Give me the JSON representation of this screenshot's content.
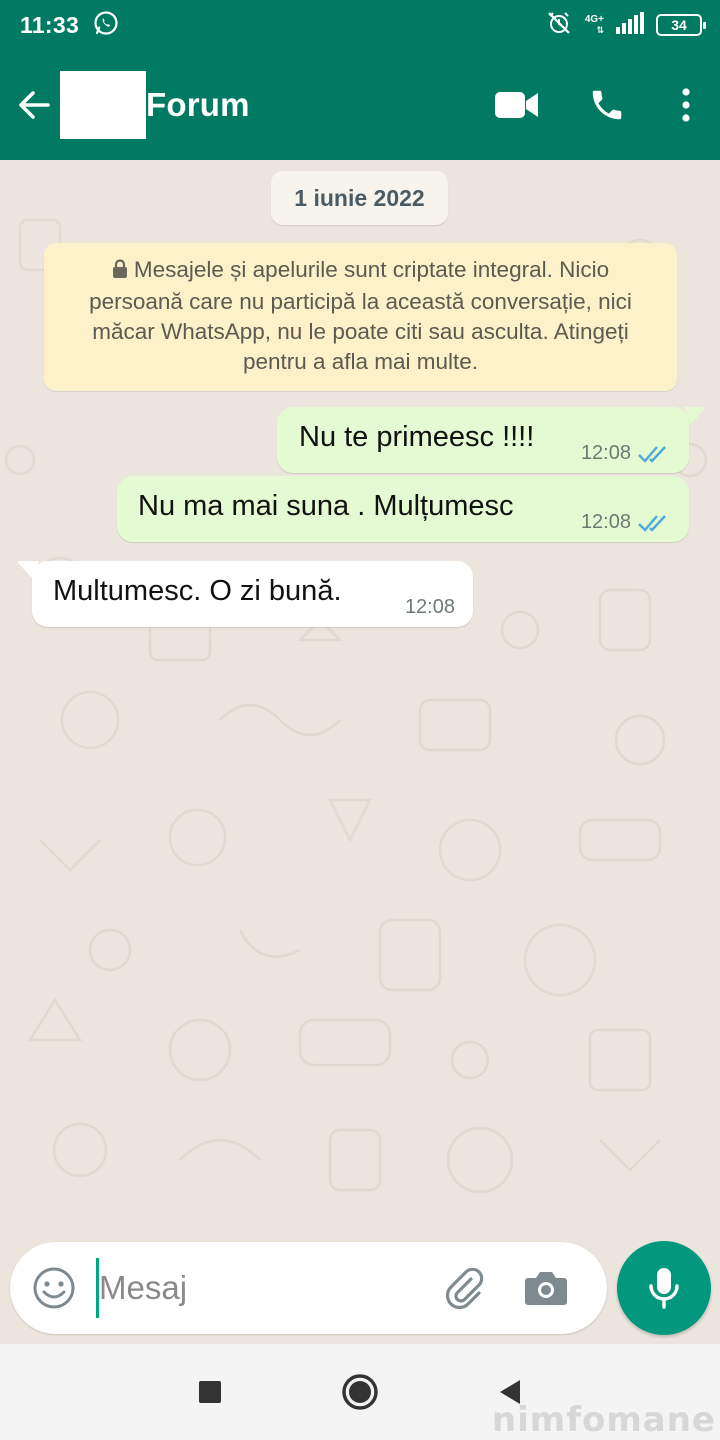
{
  "status_bar": {
    "time": "11:33",
    "network": "4G+",
    "battery": "34"
  },
  "header": {
    "title": "Forum"
  },
  "chat": {
    "date_chip": "1 iunie 2022",
    "encryption_notice": "Mesajele și apelurile sunt criptate integral. Nicio persoană care nu participă la această conversație, nici măcar WhatsApp, nu le poate citi sau asculta. Atingeți pentru a afla mai multe.",
    "messages": [
      {
        "direction": "outgoing",
        "text": "Nu te primeesc !!!!",
        "time": "12:08",
        "status": "read"
      },
      {
        "direction": "outgoing",
        "text": "Nu ma mai suna . Mulțumesc",
        "time": "12:08",
        "status": "read"
      },
      {
        "direction": "incoming",
        "text": "Multumesc. O zi bună.",
        "time": "12:08"
      }
    ]
  },
  "composer": {
    "placeholder": "Mesaj"
  },
  "watermark": "nimfomane",
  "colors": {
    "header": "#017a64",
    "background": "#ece5dd",
    "outgoing_bubble": "#e3fad2",
    "incoming_bubble": "#ffffff",
    "notice_bubble": "#fcf1c9",
    "read_ticks": "#4fa9d8",
    "mic_button": "#03977d"
  },
  "icons": {
    "status": [
      "whatsapp-icon",
      "alarm-off-icon",
      "signal-icon",
      "battery-icon"
    ],
    "header": [
      "back-arrow-icon",
      "video-call-icon",
      "phone-icon",
      "more-vert-icon"
    ],
    "composer": [
      "emoji-icon",
      "attach-icon",
      "camera-icon",
      "mic-icon"
    ],
    "nav": [
      "recents-icon",
      "home-icon",
      "back-icon"
    ]
  }
}
